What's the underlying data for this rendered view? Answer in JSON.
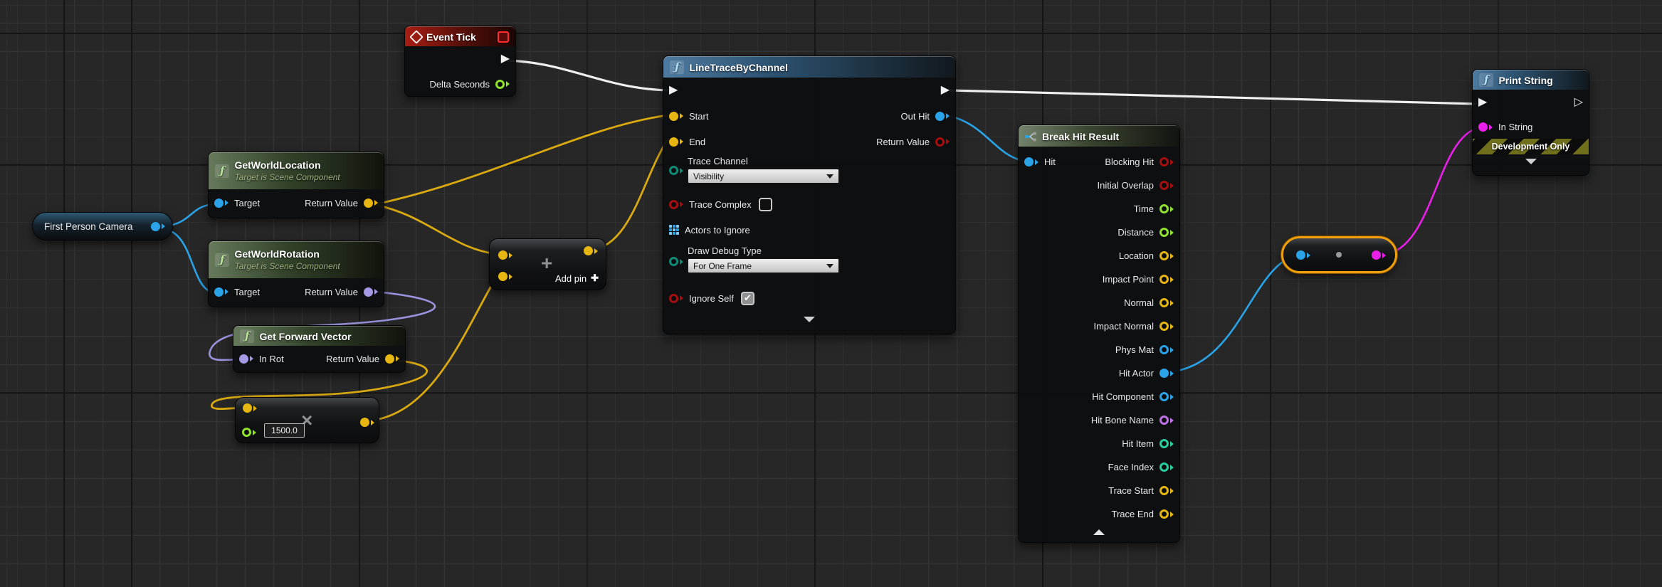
{
  "canvas": {
    "background": "#272727",
    "grid_minor": "#343434",
    "grid_major": "#141414"
  },
  "icons": {
    "function_glyph": "ƒ",
    "exec_filled": "▶",
    "exec_hollow": "▷",
    "check_glyph": "✔",
    "add_pin_glyph": "✚"
  },
  "colors": {
    "exec_wire": "#f2f2f2",
    "vector": "#e7b611",
    "rotator": "#a69ae6",
    "object": "#2aa3e8",
    "float": "#8fe22e",
    "bool": "#a50f0f",
    "enum": "#0f8a76",
    "int": "#27cf9e",
    "name": "#bd72e8",
    "string": "#ea1fea",
    "selection_outline": "#ef9f0b",
    "header_function": "#38688f",
    "header_pure": "#4f6b47",
    "header_event": "#9e1b13",
    "header_struct": "#6d7d66"
  },
  "nodes": {
    "event_tick": {
      "title": "Event Tick",
      "delta_seconds": "Delta Seconds"
    },
    "camera_variable": {
      "label": "First Person Camera"
    },
    "get_world_location": {
      "title": "GetWorldLocation",
      "subtitle": "Target is Scene Component",
      "target": "Target",
      "return_value": "Return Value"
    },
    "get_world_rotation": {
      "title": "GetWorldRotation",
      "subtitle": "Target is Scene Component",
      "target": "Target",
      "return_value": "Return Value"
    },
    "get_forward_vector": {
      "title": "Get Forward Vector",
      "in_rot": "In Rot",
      "return_value": "Return Value"
    },
    "multiply": {
      "operator": "×",
      "value": "1500.0"
    },
    "add": {
      "operator": "+",
      "add_pin_label": "Add pin"
    },
    "line_trace": {
      "title": "LineTraceByChannel",
      "start": "Start",
      "end": "End",
      "trace_channel": "Trace Channel",
      "trace_channel_value": "Visibility",
      "trace_complex": "Trace Complex",
      "actors_to_ignore": "Actors to Ignore",
      "draw_debug_type": "Draw Debug Type",
      "draw_debug_value": "For One Frame",
      "ignore_self": "Ignore Self",
      "out_hit": "Out Hit",
      "return_value": "Return Value"
    },
    "break_hit_result": {
      "title": "Break Hit Result",
      "hit": "Hit",
      "outputs": [
        {
          "label": "Blocking Hit",
          "type": "bool"
        },
        {
          "label": "Initial Overlap",
          "type": "bool"
        },
        {
          "label": "Time",
          "type": "float"
        },
        {
          "label": "Distance",
          "type": "float"
        },
        {
          "label": "Location",
          "type": "vector"
        },
        {
          "label": "Impact Point",
          "type": "vector"
        },
        {
          "label": "Normal",
          "type": "vector"
        },
        {
          "label": "Impact Normal",
          "type": "vector"
        },
        {
          "label": "Phys Mat",
          "type": "object"
        },
        {
          "label": "Hit Actor",
          "type": "object"
        },
        {
          "label": "Hit Component",
          "type": "object"
        },
        {
          "label": "Hit Bone Name",
          "type": "name"
        },
        {
          "label": "Hit Item",
          "type": "int"
        },
        {
          "label": "Face Index",
          "type": "int"
        },
        {
          "label": "Trace Start",
          "type": "vector"
        },
        {
          "label": "Trace End",
          "type": "vector"
        }
      ]
    },
    "print_string": {
      "title": "Print String",
      "in_string": "In String",
      "banner": "Development Only"
    }
  }
}
